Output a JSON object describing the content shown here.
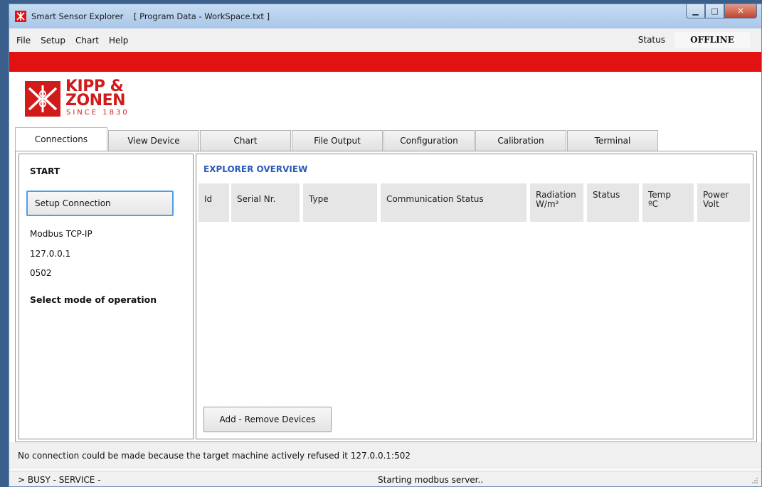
{
  "window": {
    "app_name": "Smart Sensor Explorer",
    "document": "[ Program Data - WorkSpace.txt ]"
  },
  "menu": {
    "items": [
      "File",
      "Setup",
      "Chart",
      "Help"
    ],
    "status_label": "Status",
    "status_value": "OFFLINE"
  },
  "logo": {
    "line1": "KIPP &",
    "line2": "ZONEN",
    "line3": "SINCE 1830"
  },
  "tabs": [
    "Connections",
    "View Device",
    "Chart",
    "File Output",
    "Configuration",
    "Calibration",
    "Terminal"
  ],
  "left_panel": {
    "start": "START",
    "setup_button": "Setup Connection",
    "protocol": "Modbus TCP-IP",
    "ip": "127.0.0.1",
    "port": "0502",
    "mode": "Select mode of operation"
  },
  "overview": {
    "title": "EXPLORER OVERVIEW",
    "columns": [
      {
        "line1": "Id",
        "line2": ""
      },
      {
        "line1": "Serial Nr.",
        "line2": ""
      },
      {
        "line1": "Type",
        "line2": ""
      },
      {
        "line1": "Communication Status",
        "line2": ""
      },
      {
        "line1": "Radiation",
        "line2": "W/m²"
      },
      {
        "line1": "Status",
        "line2": ""
      },
      {
        "line1": "Temp",
        "line2": "ºC"
      },
      {
        "line1": "Power",
        "line2": "Volt"
      }
    ],
    "add_button": "Add - Remove Devices"
  },
  "message": "No connection could be made because the target machine actively refused it 127.0.0.1:502",
  "statusbar": {
    "left": "> BUSY  - SERVICE -",
    "middle": "Starting modbus server.."
  },
  "colors": {
    "accent_red": "#e31212",
    "overview_title": "#2a5bb5",
    "focus_border": "#4f9ee6"
  }
}
